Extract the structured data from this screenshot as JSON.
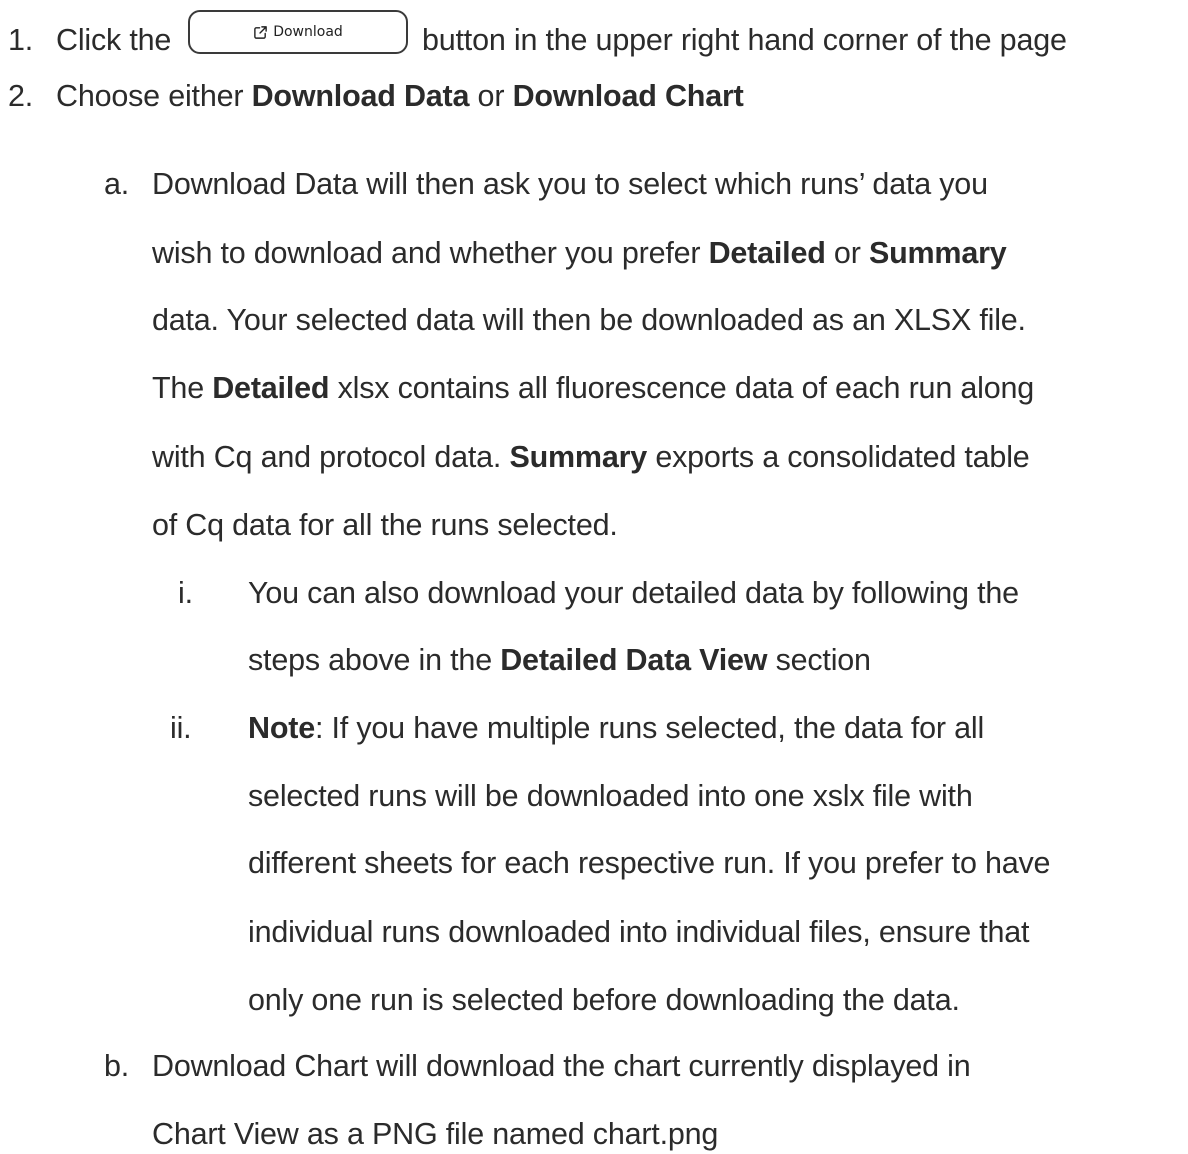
{
  "step1": {
    "marker": "1.",
    "prefix": "Click the",
    "button_label": "Download",
    "button_icon": "external-link-icon",
    "suffix": "button in the upper right hand corner of the page"
  },
  "step2": {
    "marker": "2.",
    "t1": "Choose either ",
    "b1": "Download Data",
    "t2": " or ",
    "b2": "Download Chart"
  },
  "a": {
    "marker": "a.",
    "l1": "Download Data will then ask you to select which runs’ data you",
    "l2_t1": "wish to download and whether you prefer ",
    "l2_b1": "Detailed",
    "l2_t2": " or ",
    "l2_b2": "Summary",
    "l3": "data. Your selected data will then be downloaded as an XLSX file.",
    "l4_t1": "The ",
    "l4_b1": "Detailed",
    "l4_t2": " xlsx contains all fluorescence data of each run along",
    "l5_t1": "with Cq and protocol data. ",
    "l5_b1": "Summary",
    "l5_t2": " exports a consolidated table",
    "l6": "of Cq data for all the runs selected."
  },
  "i": {
    "marker": "i.",
    "l1": "You can also download your detailed data by following the",
    "l2_t1": "steps above in the ",
    "l2_b1": "Detailed Data View",
    "l2_t2": " section"
  },
  "ii": {
    "marker": "ii.",
    "l1_b1": "Note",
    "l1_t1": ": If you have multiple runs selected, the data for all",
    "l2": "selected runs will be downloaded into one xslx file with",
    "l3": "different sheets for each respective run. If you prefer to have",
    "l4": "individual runs downloaded into individual files, ensure that",
    "l5": "only one run is selected before downloading the data."
  },
  "b": {
    "marker": "b.",
    "l1": "Download Chart will download the chart currently displayed in",
    "l2": "Chart View as a PNG file named chart.png"
  }
}
